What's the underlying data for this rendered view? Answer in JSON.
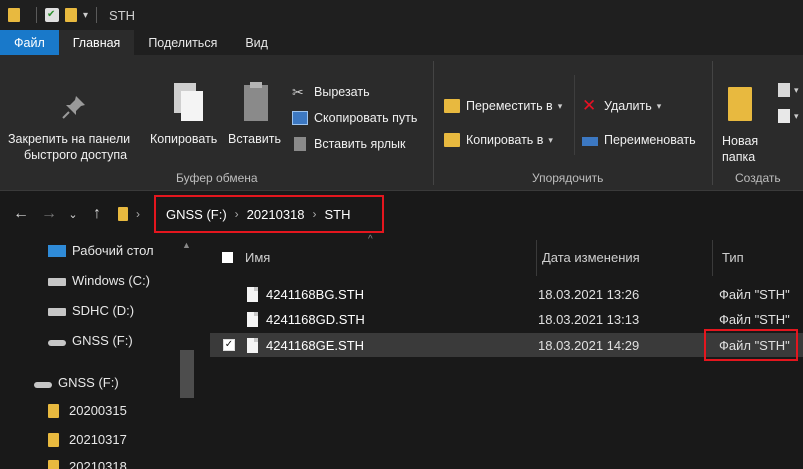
{
  "window": {
    "title": "STH"
  },
  "tabs": [
    "Файл",
    "Главная",
    "Поделиться",
    "Вид"
  ],
  "ribbon": {
    "pin_label": "Закрепить на панели быстрого доступа",
    "pin_line1": "Закрепить на панели",
    "pin_line2": "быстрого доступа",
    "copy_label": "Копировать",
    "paste_label": "Вставить",
    "cut_label": "Вырезать",
    "copy_path_label": "Скопировать путь",
    "paste_shortcut_label": "Вставить ярлык",
    "clipboard_group": "Буфер обмена",
    "move_to_label": "Переместить в",
    "copy_to_label": "Копировать в",
    "delete_label": "Удалить",
    "rename_label": "Переименовать",
    "organize_group": "Упорядочить",
    "new_folder_line1": "Новая",
    "new_folder_line2": "папка",
    "create_group": "Создать"
  },
  "address": {
    "crumbs": [
      "GNSS (F:)",
      "20210318",
      "STH"
    ]
  },
  "nav": {
    "items": [
      "Рабочий стол",
      "Windows (C:)",
      "SDHC (D:)",
      "GNSS (F:)",
      "GNSS (F:)",
      "20200315",
      "20210317",
      "20210318"
    ]
  },
  "columns": {
    "name": "Имя",
    "date": "Дата изменения",
    "type": "Тип"
  },
  "files": [
    {
      "name": "4241168BG.STH",
      "date": "18.03.2021 13:26",
      "type": "Файл \"STH\""
    },
    {
      "name": "4241168GD.STH",
      "date": "18.03.2021 13:13",
      "type": "Файл \"STH\""
    },
    {
      "name": "4241168GE.STH",
      "date": "18.03.2021 14:29",
      "type": "Файл \"STH\""
    }
  ],
  "colors": {
    "accent": "#1979ca",
    "highlight": "#e4161e",
    "folder": "#e8b93f"
  }
}
